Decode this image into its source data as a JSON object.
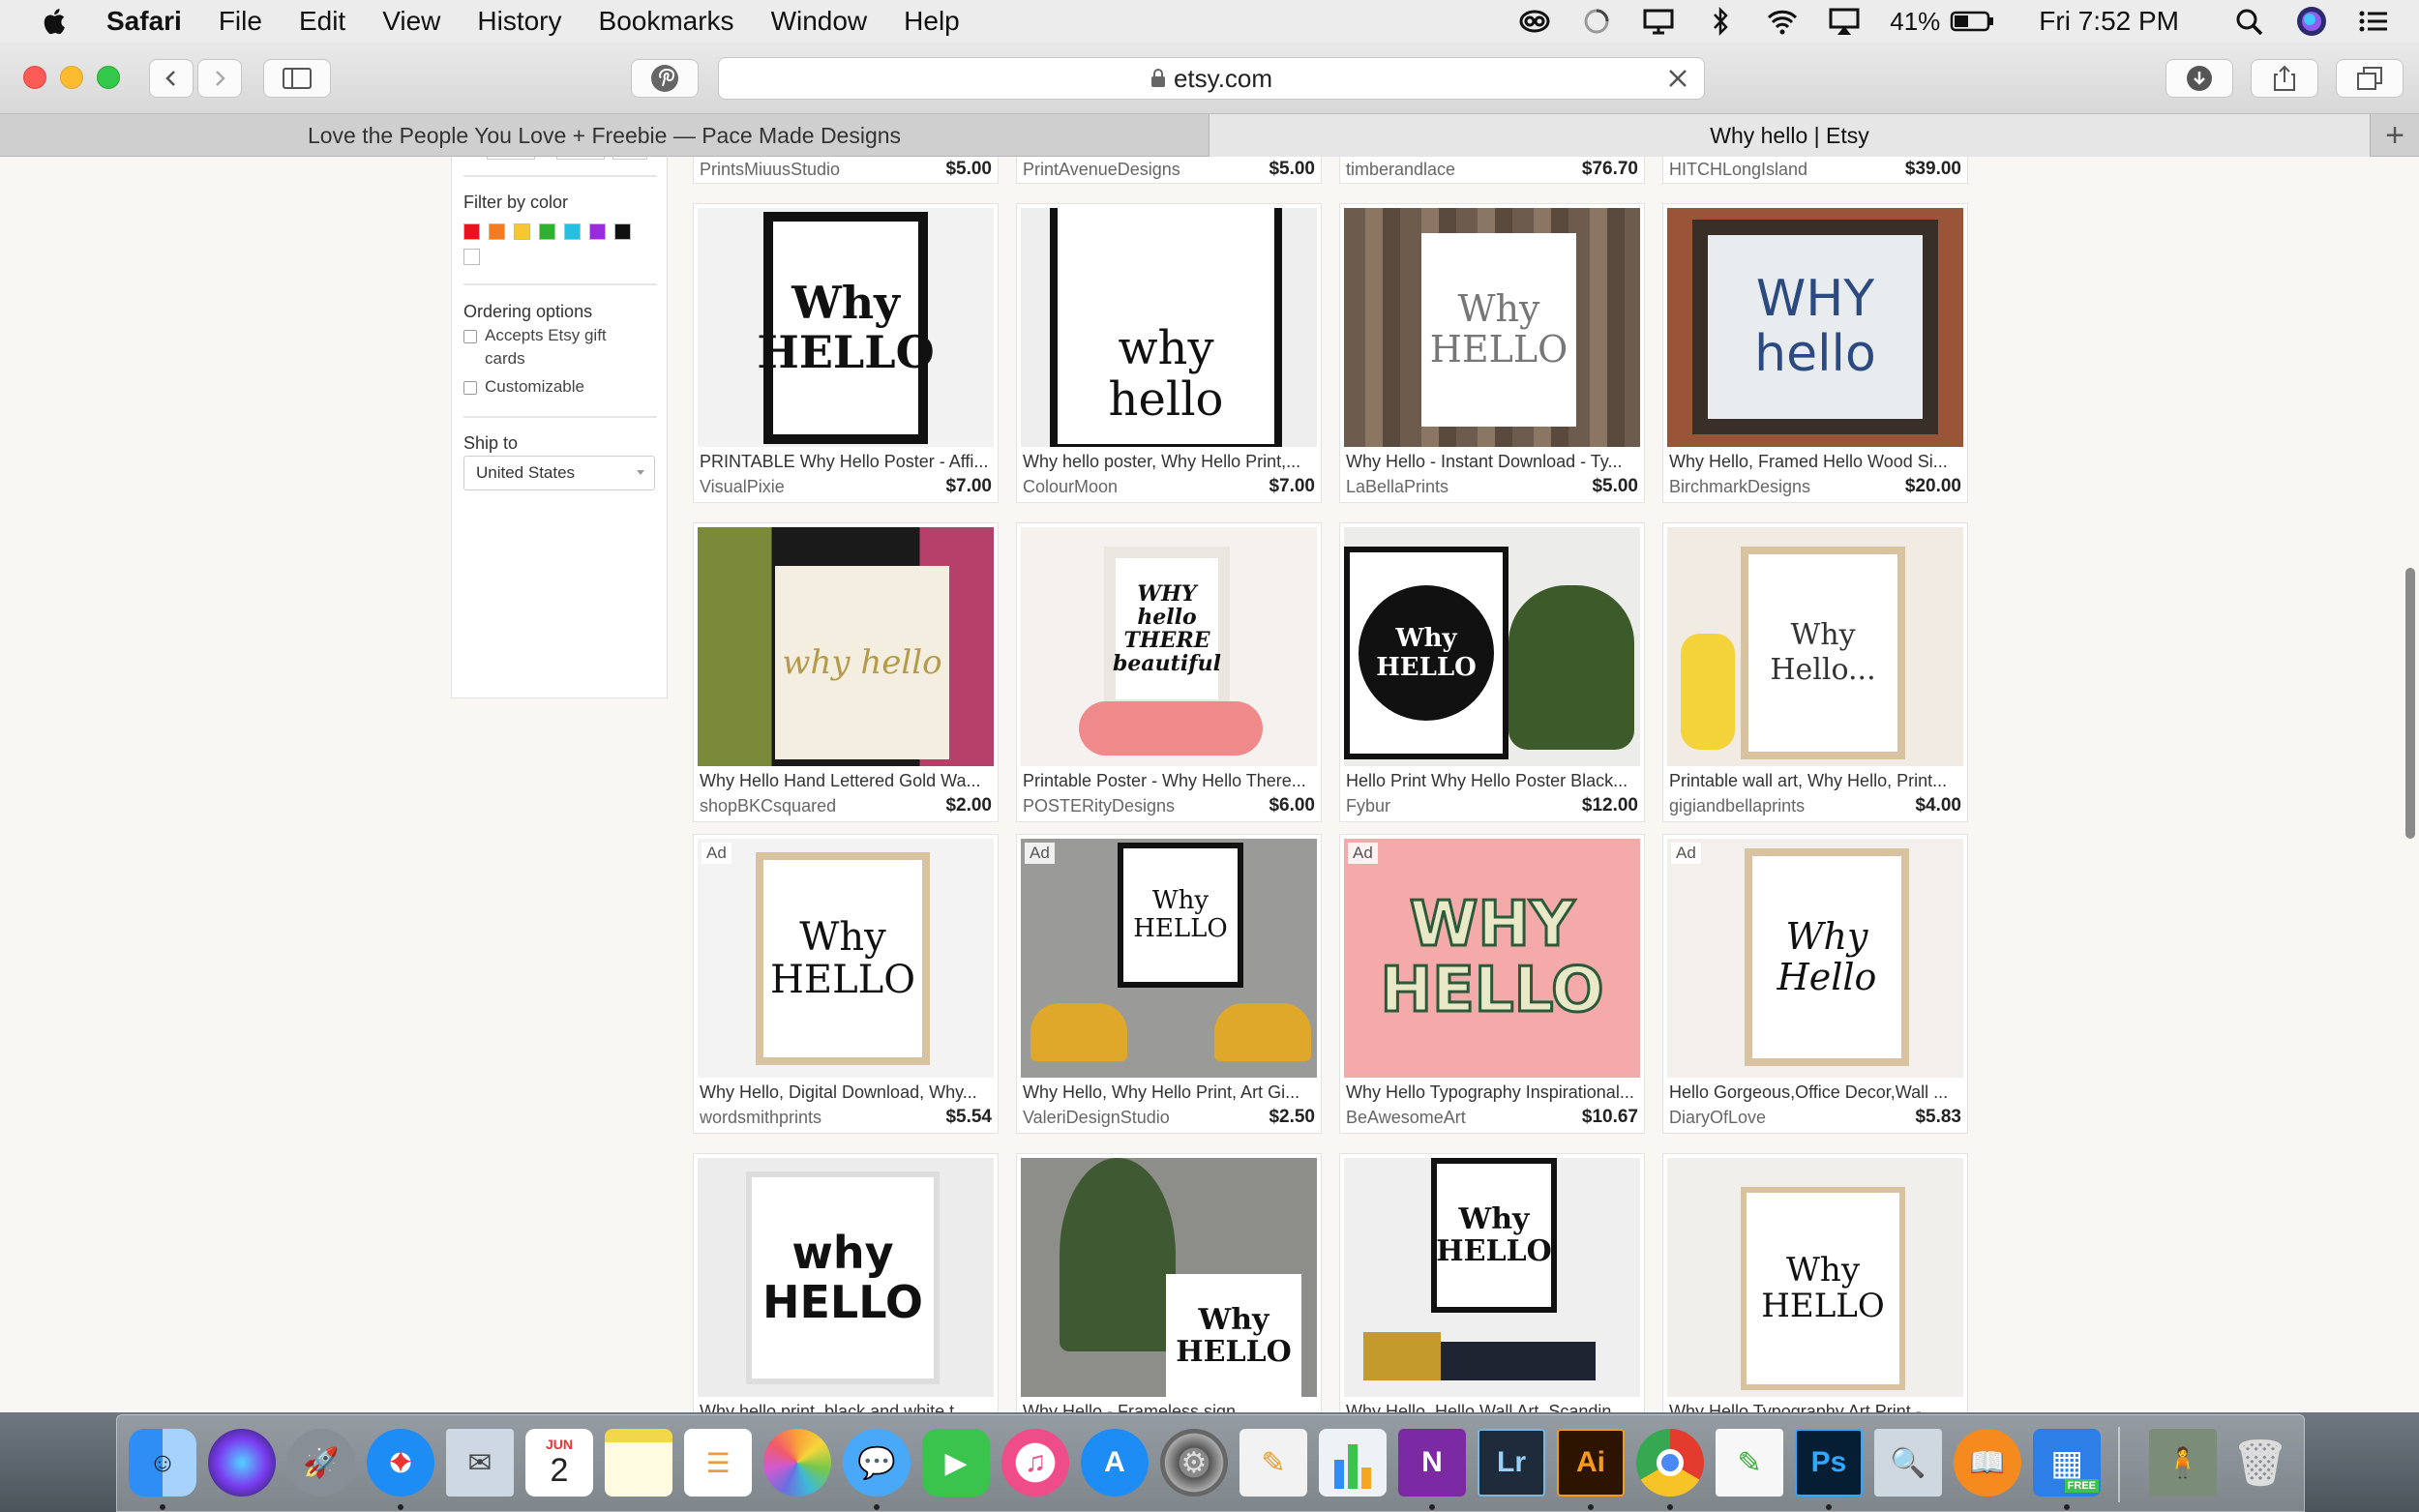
{
  "menubar": {
    "app": "Safari",
    "items": [
      "File",
      "Edit",
      "View",
      "History",
      "Bookmarks",
      "Window",
      "Help"
    ],
    "battery": "41%",
    "clock": "Fri 7:52 PM"
  },
  "toolbar": {
    "url": "etsy.com"
  },
  "tabs": [
    {
      "label": "Love the People You Love + Freebie — Pace Made Designs"
    },
    {
      "label": "Why hello | Etsy"
    }
  ],
  "sidebar": {
    "filter_color_heading": "Filter by color",
    "swatch_colors": [
      "#e8141d",
      "#f27c1e",
      "#f6c633",
      "#2fb02f",
      "#25c0e0",
      "#9a2bdc",
      "#111111",
      "#ffffff"
    ],
    "ordering_heading": "Ordering options",
    "options": [
      "Accepts Etsy gift cards",
      "Customizable"
    ],
    "ship_heading": "Ship to",
    "ship_value": "United States"
  },
  "top_row": [
    {
      "shop": "PrintsMiuusStudio",
      "price": "$5.00"
    },
    {
      "shop": "PrintAvenueDesigns",
      "price": "$5.00"
    },
    {
      "shop": "timberandlace",
      "price": "$76.70"
    },
    {
      "shop": "HITCHLongIsland",
      "price": "$39.00"
    }
  ],
  "listings": [
    [
      {
        "title": "PRINTABLE Why Hello Poster - Affi...",
        "shop": "VisualPixie",
        "price": "$7.00",
        "art": "Why HELLO"
      },
      {
        "title": "Why hello poster, Why Hello Print,...",
        "shop": "ColourMoon",
        "price": "$7.00",
        "art": "why hello"
      },
      {
        "title": "Why Hello - Instant Download - Ty...",
        "shop": "LaBellaPrints",
        "price": "$5.00",
        "art": "Why HELLO"
      },
      {
        "title": "Why Hello, Framed Hello Wood Si...",
        "shop": "BirchmarkDesigns",
        "price": "$20.00",
        "art": "WHY hello"
      }
    ],
    [
      {
        "title": "Why Hello Hand Lettered Gold Wa...",
        "shop": "shopBKCsquared",
        "price": "$2.00",
        "art": "why hello"
      },
      {
        "title": "Printable Poster - Why Hello There...",
        "shop": "POSTERityDesigns",
        "price": "$6.00",
        "art": "WHY hello THERE beautiful"
      },
      {
        "title": "Hello Print Why Hello Poster Black...",
        "shop": "Fybur",
        "price": "$12.00",
        "art": "Why HELLO"
      },
      {
        "title": "Printable wall art, Why Hello, Print...",
        "shop": "gigiandbellaprints",
        "price": "$4.00",
        "art": "Why Hello..."
      }
    ],
    [
      {
        "ad": "Ad",
        "title": "Why Hello, Digital Download, Why...",
        "shop": "wordsmithprints",
        "price": "$5.54",
        "art": "Why HELLO"
      },
      {
        "ad": "Ad",
        "title": "Why Hello, Why Hello Print, Art Gi...",
        "shop": "ValeriDesignStudio",
        "price": "$2.50",
        "art": "Why HELLO"
      },
      {
        "ad": "Ad",
        "title": "Why Hello Typography Inspirational...",
        "shop": "BeAwesomeArt",
        "price": "$10.67",
        "art": "WHY HELLO"
      },
      {
        "ad": "Ad",
        "title": "Hello Gorgeous,Office Decor,Wall ...",
        "shop": "DiaryOfLove",
        "price": "$5.83",
        "art": "Why Hello"
      }
    ],
    [
      {
        "title": "Why hello print, black and white t...",
        "art": "why HELLO"
      },
      {
        "title": "Why Hello - Frameless sign",
        "art": "Why HELLO"
      },
      {
        "title": "Why Hello, Hello Wall Art, Scandin...",
        "art": "Why HELLO"
      },
      {
        "title": "Why Hello Typography Art Print -",
        "art": "Why HELLO"
      }
    ]
  ],
  "dock": {
    "calendar_month": "JUN",
    "calendar_day": "2",
    "lightroom": "Lr",
    "illustrator": "Ai",
    "photoshop": "Ps",
    "free_badge": "FREE"
  }
}
